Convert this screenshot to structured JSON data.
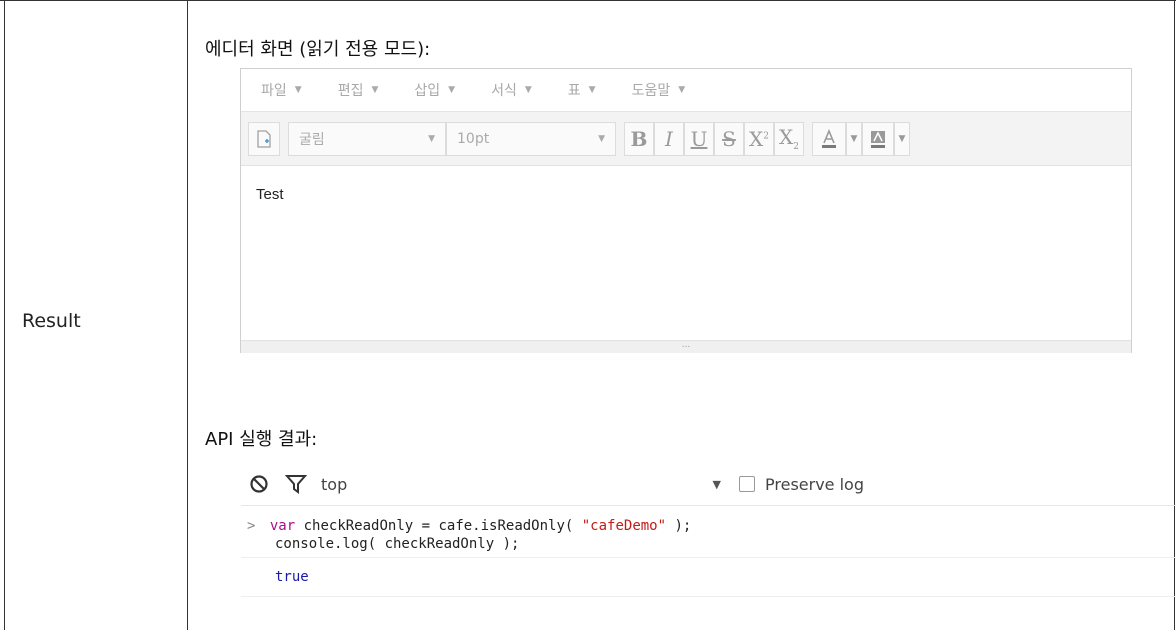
{
  "row_label": "Result",
  "editor_section_title": "에디터 화면 (읽기 전용 모드):",
  "editor": {
    "menu": [
      {
        "label": "파일",
        "name": "menu-file"
      },
      {
        "label": "편집",
        "name": "menu-edit"
      },
      {
        "label": "삽입",
        "name": "menu-insert"
      },
      {
        "label": "서식",
        "name": "menu-format"
      },
      {
        "label": "표",
        "name": "menu-table"
      },
      {
        "label": "도움말",
        "name": "menu-help"
      }
    ],
    "font_family": "굴림",
    "font_size": "10pt",
    "content": "Test",
    "status_dots": "..."
  },
  "api_section_title": "API 실행 결과:",
  "console": {
    "context": "top",
    "preserve_log_label": "Preserve log",
    "input_prompt": ">",
    "code_kw": "var",
    "code_line1_mid": " checkReadOnly = cafe.isReadOnly( ",
    "code_string": "\"cafeDemo\"",
    "code_line1_end": " );",
    "code_line2": "console.log( checkReadOnly );",
    "result": "true"
  },
  "colors": {
    "keyword": "#aa0d91",
    "string": "#c41a16",
    "boolean": "#1a1aa6"
  }
}
